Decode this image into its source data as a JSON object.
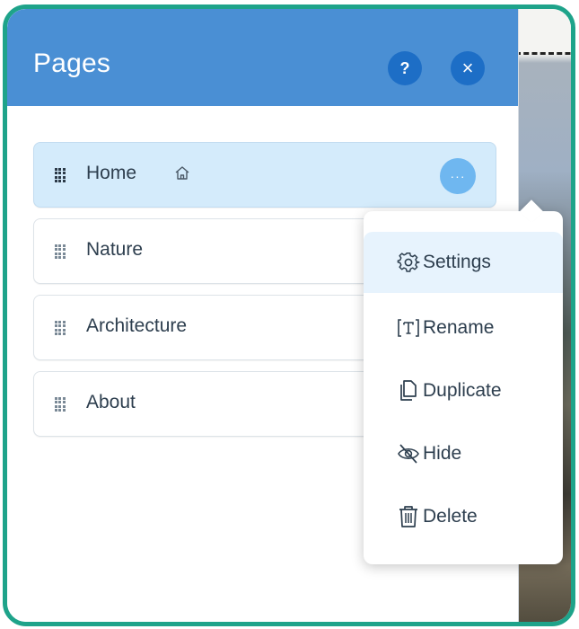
{
  "panel": {
    "title": "Pages",
    "help_label": "?",
    "close_label": "×"
  },
  "pages": [
    {
      "label": "Home",
      "is_home": true,
      "selected": true
    },
    {
      "label": "Nature",
      "is_home": false,
      "selected": false
    },
    {
      "label": "Architecture",
      "is_home": false,
      "selected": false
    },
    {
      "label": "About",
      "is_home": false,
      "selected": false
    }
  ],
  "more_button_label": "···",
  "context_menu": {
    "items": [
      {
        "label": "Settings",
        "icon": "gear-icon"
      },
      {
        "label": "Rename",
        "icon": "rename-icon"
      },
      {
        "label": "Duplicate",
        "icon": "duplicate-icon"
      },
      {
        "label": "Hide",
        "icon": "eye-slash-icon"
      },
      {
        "label": "Delete",
        "icon": "trash-icon"
      }
    ]
  },
  "colors": {
    "header": "#4a8fd4",
    "header_button": "#1d6ec6",
    "selected_row": "#d4ebfb",
    "more_button": "#6fb7f0",
    "frame": "#1ea38a"
  }
}
